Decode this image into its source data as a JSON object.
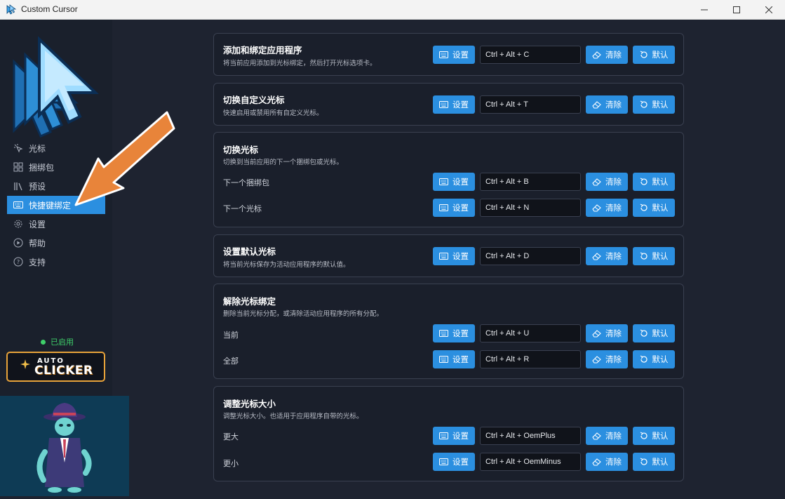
{
  "window": {
    "title": "Custom Cursor",
    "minimize": "—",
    "maximize": "☐",
    "close": "✕"
  },
  "sidebar": {
    "items": [
      {
        "label": "光标",
        "icon": "cursor-click-icon",
        "active": false
      },
      {
        "label": "捆绑包",
        "icon": "grid-icon",
        "active": false
      },
      {
        "label": "预设",
        "icon": "library-icon",
        "active": false
      },
      {
        "label": "快捷键绑定",
        "icon": "keyboard-icon",
        "active": true
      },
      {
        "label": "设置",
        "icon": "gear-icon",
        "active": false
      },
      {
        "label": "帮助",
        "icon": "play-circle-icon",
        "active": false
      },
      {
        "label": "支持",
        "icon": "question-circle-icon",
        "active": false
      }
    ],
    "status": "已启用",
    "promo": {
      "line1": "AUTO",
      "line2": "CLICKER"
    }
  },
  "buttons": {
    "set": "设置",
    "clear": "清除",
    "default": "默认"
  },
  "cards": [
    {
      "title": "添加和绑定应用程序",
      "desc": "将当前应用添加到光标绑定，然后打开光标选项卡。",
      "rows": [
        {
          "label": "",
          "hotkey": "Ctrl + Alt + C"
        }
      ]
    },
    {
      "title": "切换自定义光标",
      "desc": "快速启用或禁用所有自定义光标。",
      "rows": [
        {
          "label": "",
          "hotkey": "Ctrl + Alt + T"
        }
      ]
    },
    {
      "title": "切换光标",
      "desc": "切换到当前应用的下一个捆绑包或光标。",
      "rows": [
        {
          "label": "下一个捆绑包",
          "hotkey": "Ctrl + Alt + B"
        },
        {
          "label": "下一个光标",
          "hotkey": "Ctrl + Alt + N"
        }
      ]
    },
    {
      "title": "设置默认光标",
      "desc": "将当前光标保存为活动应用程序的默认值。",
      "rows": [
        {
          "label": "",
          "hotkey": "Ctrl + Alt + D"
        }
      ]
    },
    {
      "title": "解除光标绑定",
      "desc": "删除当前光标分配，或清除活动应用程序的所有分配。",
      "rows": [
        {
          "label": "当前",
          "hotkey": "Ctrl + Alt + U"
        },
        {
          "label": "全部",
          "hotkey": "Ctrl + Alt + R"
        }
      ]
    },
    {
      "title": "调整光标大小",
      "desc": "调整光标大小。也适用于应用程序自带的光标。",
      "rows": [
        {
          "label": "更大",
          "hotkey": "Ctrl + Alt + OemPlus"
        },
        {
          "label": "更小",
          "hotkey": "Ctrl + Alt + OemMinus"
        }
      ]
    }
  ],
  "colors": {
    "accent": "#2b8fe0",
    "background": "#1e2330",
    "card": "#1a1f2b",
    "status": "#3fcf6a",
    "arrow": "#e8843a"
  }
}
